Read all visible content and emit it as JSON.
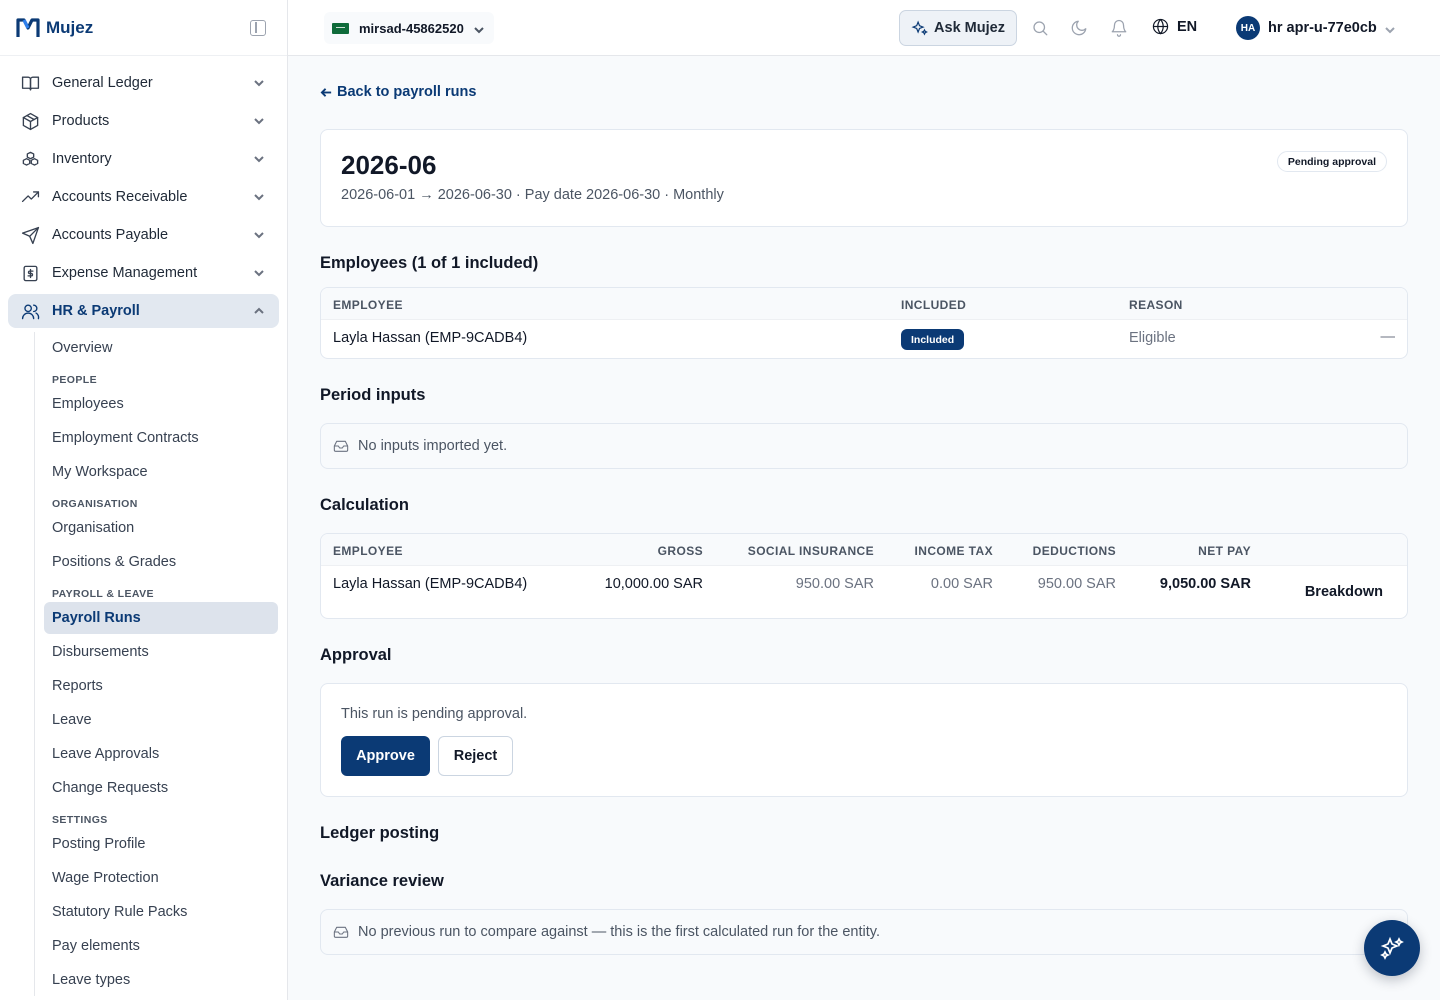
{
  "brand": {
    "name": "Mujez"
  },
  "sidebar": {
    "items": [
      {
        "label": "General Ledger",
        "icon": "book-open-icon"
      },
      {
        "label": "Products",
        "icon": "package-icon"
      },
      {
        "label": "Inventory",
        "icon": "boxes-icon"
      },
      {
        "label": "Accounts Receivable",
        "icon": "trending-up-icon"
      },
      {
        "label": "Accounts Payable",
        "icon": "send-icon"
      },
      {
        "label": "Expense Management",
        "icon": "receipt-icon"
      },
      {
        "label": "HR & Payroll",
        "icon": "users-icon"
      }
    ],
    "hr": {
      "overview": "Overview",
      "section_people": "PEOPLE",
      "employees": "Employees",
      "employment_contracts": "Employment Contracts",
      "my_workspace": "My Workspace",
      "section_organisation": "ORGANISATION",
      "organisation": "Organisation",
      "positions_grades": "Positions & Grades",
      "section_payroll_leave": "PAYROLL & LEAVE",
      "payroll_runs": "Payroll Runs",
      "disbursements": "Disbursements",
      "reports": "Reports",
      "leave": "Leave",
      "leave_approvals": "Leave Approvals",
      "change_requests": "Change Requests",
      "section_settings": "SETTINGS",
      "posting_profile": "Posting Profile",
      "wage_protection": "Wage Protection",
      "statutory_rule_packs": "Statutory Rule Packs",
      "pay_elements": "Pay elements",
      "leave_types": "Leave types"
    }
  },
  "topbar": {
    "entity": "mirsad-45862520",
    "ask_label": "Ask Mujez",
    "language": "EN",
    "user_initials": "HA",
    "user_name": "hr apr-u-77e0cb"
  },
  "page": {
    "back_label": "Back to payroll runs",
    "run_title": "2026-06",
    "run_meta": "2026-06-01 → 2026-06-30 · Pay date 2026-06-30 · Monthly",
    "status": "Pending approval",
    "employees_title": "Employees (1 of 1 included)",
    "employees_table": {
      "headers": {
        "employee": "EMPLOYEE",
        "included": "INCLUDED",
        "reason": "REASON"
      },
      "rows": [
        {
          "employee": "Layla Hassan (EMP-9CADB4)",
          "included": "Included",
          "reason": "Eligible",
          "action": "—"
        }
      ]
    },
    "period_inputs_title": "Period inputs",
    "period_inputs_empty": "No inputs imported yet.",
    "calculation_title": "Calculation",
    "calculation_table": {
      "headers": {
        "employee": "EMPLOYEE",
        "gross": "GROSS",
        "social_insurance": "SOCIAL INSURANCE",
        "income_tax": "INCOME TAX",
        "deductions": "DEDUCTIONS",
        "net_pay": "NET PAY"
      },
      "rows": [
        {
          "employee": "Layla Hassan (EMP-9CADB4)",
          "gross": "10,000.00 SAR",
          "social_insurance": "950.00 SAR",
          "income_tax": "0.00 SAR",
          "deductions": "950.00 SAR",
          "net_pay": "9,050.00 SAR",
          "action": "Breakdown"
        }
      ]
    },
    "approval_title": "Approval",
    "approval_text": "This run is pending approval.",
    "approve_label": "Approve",
    "reject_label": "Reject",
    "ledger_title": "Ledger posting",
    "variance_title": "Variance review",
    "variance_empty": "No previous run to compare against — this is the first calculated run for the entity."
  },
  "colors": {
    "brand": "#0b3a75",
    "accent_light": "#e2e8f0",
    "background": "#f8fafc"
  }
}
